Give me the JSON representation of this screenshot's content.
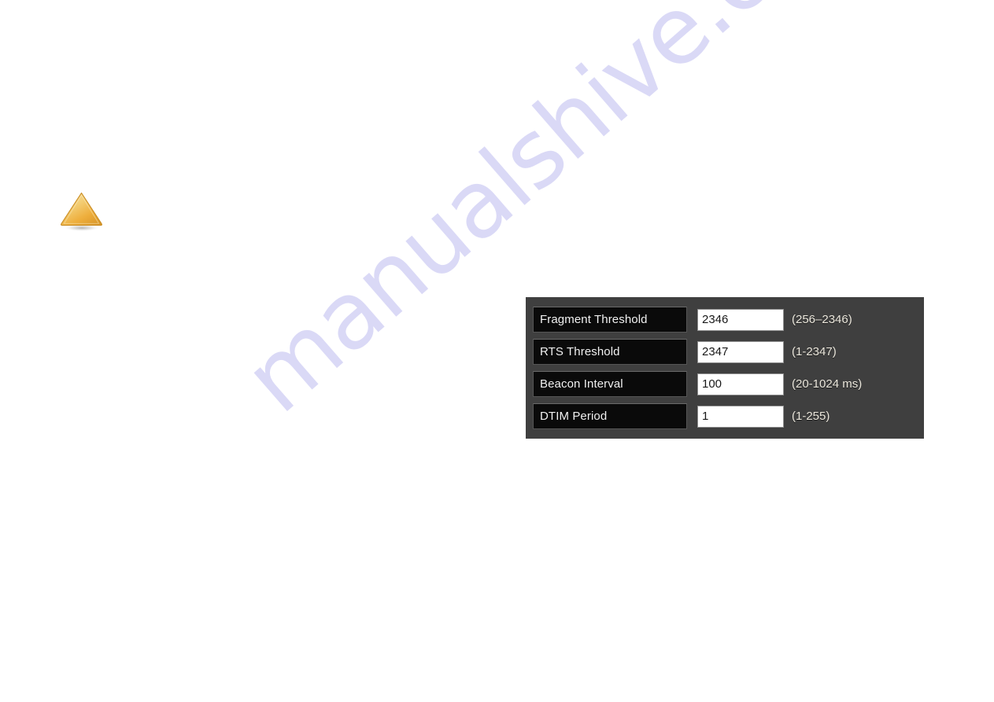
{
  "page": {
    "background_color": "#ffffff"
  },
  "watermark": {
    "text": "manualshive.com",
    "color": "#d9d8f6"
  },
  "warning_icon": {
    "name": "warning-triangle-icon",
    "fill_light": "#f6dc8e",
    "fill_mid": "#f0b94a",
    "fill_dark": "#d99a28",
    "shadow_color": "#b8b8b8"
  },
  "settings_panel": {
    "background_color": "#3f3f3f",
    "label_background_color": "#0a0a0a",
    "label_text_color": "#f2f2f2",
    "input_background_color": "#ffffff",
    "input_text_color": "#181818",
    "hint_text_color": "#ece8dd",
    "rows": [
      {
        "label": "Fragment Threshold",
        "value": "2346",
        "hint": "(256–2346)"
      },
      {
        "label": "RTS Threshold",
        "value": "2347",
        "hint": "(1-2347)"
      },
      {
        "label": "Beacon Interval",
        "value": "100",
        "hint": "(20-1024 ms)"
      },
      {
        "label": "DTIM Period",
        "value": "1",
        "hint": "(1-255)"
      }
    ]
  }
}
